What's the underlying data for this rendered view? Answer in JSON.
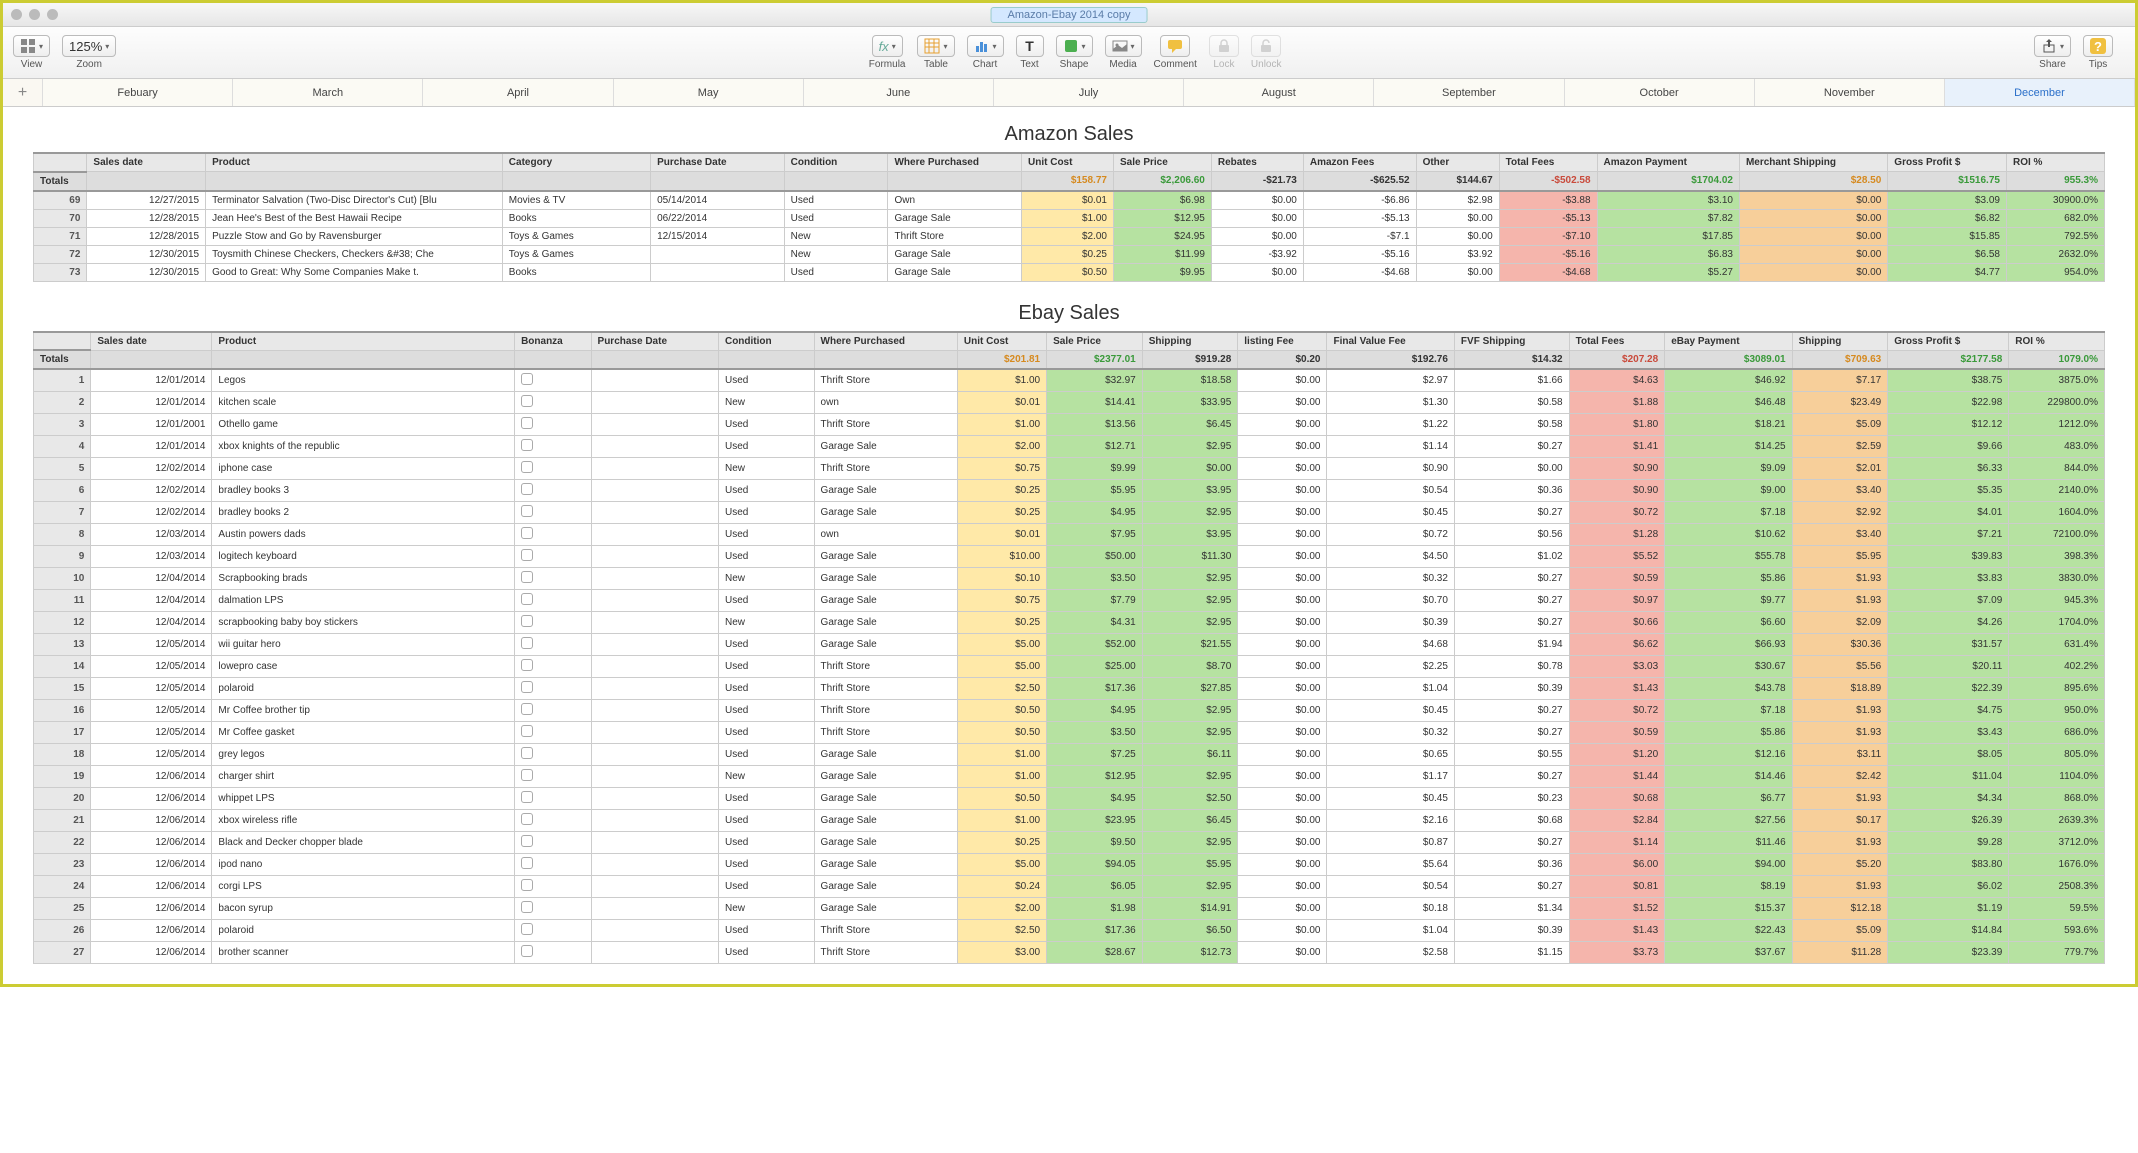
{
  "window": {
    "title": "Amazon-Ebay 2014 copy"
  },
  "toolbar": {
    "view": "View",
    "zoom": "Zoom",
    "zoom_val": "125%",
    "formula": "Formula",
    "table": "Table",
    "chart": "Chart",
    "text": "Text",
    "shape": "Shape",
    "media": "Media",
    "comment": "Comment",
    "lock": "Lock",
    "unlock": "Unlock",
    "share": "Share",
    "tips": "Tips"
  },
  "tabs": [
    "Febuary",
    "March",
    "April",
    "May",
    "June",
    "July",
    "August",
    "September",
    "October",
    "November",
    "December"
  ],
  "active_tab": 10,
  "amazon": {
    "title": "Amazon Sales",
    "headers": [
      "Sales date",
      "Product",
      "Category",
      "Purchase Date",
      "Condition",
      "Where Purchased",
      "Unit Cost",
      "Sale Price",
      "Rebates",
      "Amazon Fees",
      "Other",
      "Total Fees",
      "Amazon Payment",
      "Merchant Shipping",
      "Gross Profit $",
      "ROI %"
    ],
    "totals_label": "Totals",
    "totals": [
      "",
      "",
      "",
      "",
      "",
      "",
      "$158.77",
      "$2,206.60",
      "-$21.73",
      "-$625.52",
      "$144.67",
      "-$502.58",
      "$1704.02",
      "$28.50",
      "$1516.75",
      "955.3%"
    ],
    "rows": [
      {
        "n": "69",
        "d": [
          "12/27/2015",
          "Terminator Salvation (Two-Disc Director's Cut) [Blu",
          "Movies & TV",
          "05/14/2014",
          "Used",
          "Own",
          "$0.01",
          "$6.98",
          "$0.00",
          "-$6.86",
          "$2.98",
          "-$3.88",
          "$3.10",
          "$0.00",
          "$3.09",
          "30900.0%"
        ]
      },
      {
        "n": "70",
        "d": [
          "12/28/2015",
          "Jean Hee's Best of the Best Hawaii Recipe",
          "Books",
          "06/22/2014",
          "Used",
          "Garage Sale",
          "$1.00",
          "$12.95",
          "$0.00",
          "-$5.13",
          "$0.00",
          "-$5.13",
          "$7.82",
          "$0.00",
          "$6.82",
          "682.0%"
        ]
      },
      {
        "n": "71",
        "d": [
          "12/28/2015",
          "Puzzle Stow and Go by Ravensburger",
          "Toys & Games",
          "12/15/2014",
          "New",
          "Thrift Store",
          "$2.00",
          "$24.95",
          "$0.00",
          "-$7.1",
          "$0.00",
          "-$7.10",
          "$17.85",
          "$0.00",
          "$15.85",
          "792.5%"
        ]
      },
      {
        "n": "72",
        "d": [
          "12/30/2015",
          "Toysmith Chinese Checkers, Checkers &#38; Che",
          "Toys & Games",
          "",
          "New",
          "Garage Sale",
          "$0.25",
          "$11.99",
          "-$3.92",
          "-$5.16",
          "$3.92",
          "-$5.16",
          "$6.83",
          "$0.00",
          "$6.58",
          "2632.0%"
        ]
      },
      {
        "n": "73",
        "d": [
          "12/30/2015",
          "Good to Great: Why Some Companies Make t.",
          "Books",
          "",
          "Used",
          "Garage Sale",
          "$0.50",
          "$9.95",
          "$0.00",
          "-$4.68",
          "$0.00",
          "-$4.68",
          "$5.27",
          "$0.00",
          "$4.77",
          "954.0%"
        ]
      }
    ]
  },
  "ebay": {
    "title": "Ebay Sales",
    "headers": [
      "Sales date",
      "Product",
      "Bonanza",
      "Purchase Date",
      "Condition",
      "Where Purchased",
      "Unit Cost",
      "Sale Price",
      "Shipping",
      "listing Fee",
      "Final Value Fee",
      "FVF Shipping",
      "Total Fees",
      "eBay Payment",
      "Shipping",
      "Gross Profit $",
      "ROI %"
    ],
    "totals_label": "Totals",
    "totals": [
      "",
      "",
      "",
      "",
      "",
      "",
      "$201.81",
      "$2377.01",
      "$919.28",
      "$0.20",
      "$192.76",
      "$14.32",
      "$207.28",
      "$3089.01",
      "$709.63",
      "$2177.58",
      "1079.0%"
    ],
    "rows": [
      {
        "n": "1",
        "d": [
          "12/01/2014",
          "Legos",
          "",
          "",
          "Used",
          "Thrift Store",
          "$1.00",
          "$32.97",
          "$18.58",
          "$0.00",
          "$2.97",
          "$1.66",
          "$4.63",
          "$46.92",
          "$7.17",
          "$38.75",
          "3875.0%"
        ]
      },
      {
        "n": "2",
        "d": [
          "12/01/2014",
          "kitchen scale",
          "",
          "",
          "New",
          "own",
          "$0.01",
          "$14.41",
          "$33.95",
          "$0.00",
          "$1.30",
          "$0.58",
          "$1.88",
          "$46.48",
          "$23.49",
          "$22.98",
          "229800.0%"
        ]
      },
      {
        "n": "3",
        "d": [
          "12/01/2001",
          "Othello game",
          "",
          "",
          "Used",
          "Thrift Store",
          "$1.00",
          "$13.56",
          "$6.45",
          "$0.00",
          "$1.22",
          "$0.58",
          "$1.80",
          "$18.21",
          "$5.09",
          "$12.12",
          "1212.0%"
        ]
      },
      {
        "n": "4",
        "d": [
          "12/01/2014",
          "xbox knights of the republic",
          "",
          "",
          "Used",
          "Garage Sale",
          "$2.00",
          "$12.71",
          "$2.95",
          "$0.00",
          "$1.14",
          "$0.27",
          "$1.41",
          "$14.25",
          "$2.59",
          "$9.66",
          "483.0%"
        ]
      },
      {
        "n": "5",
        "d": [
          "12/02/2014",
          "iphone case",
          "",
          "",
          "New",
          "Thrift Store",
          "$0.75",
          "$9.99",
          "$0.00",
          "$0.00",
          "$0.90",
          "$0.00",
          "$0.90",
          "$9.09",
          "$2.01",
          "$6.33",
          "844.0%"
        ]
      },
      {
        "n": "6",
        "d": [
          "12/02/2014",
          "bradley books 3",
          "",
          "",
          "Used",
          "Garage Sale",
          "$0.25",
          "$5.95",
          "$3.95",
          "$0.00",
          "$0.54",
          "$0.36",
          "$0.90",
          "$9.00",
          "$3.40",
          "$5.35",
          "2140.0%"
        ]
      },
      {
        "n": "7",
        "d": [
          "12/02/2014",
          "bradley books 2",
          "",
          "",
          "Used",
          "Garage Sale",
          "$0.25",
          "$4.95",
          "$2.95",
          "$0.00",
          "$0.45",
          "$0.27",
          "$0.72",
          "$7.18",
          "$2.92",
          "$4.01",
          "1604.0%"
        ]
      },
      {
        "n": "8",
        "d": [
          "12/03/2014",
          "Austin powers dads",
          "",
          "",
          "Used",
          "own",
          "$0.01",
          "$7.95",
          "$3.95",
          "$0.00",
          "$0.72",
          "$0.56",
          "$1.28",
          "$10.62",
          "$3.40",
          "$7.21",
          "72100.0%"
        ]
      },
      {
        "n": "9",
        "d": [
          "12/03/2014",
          "logitech keyboard",
          "",
          "",
          "Used",
          "Garage Sale",
          "$10.00",
          "$50.00",
          "$11.30",
          "$0.00",
          "$4.50",
          "$1.02",
          "$5.52",
          "$55.78",
          "$5.95",
          "$39.83",
          "398.3%"
        ]
      },
      {
        "n": "10",
        "d": [
          "12/04/2014",
          "Scrapbooking brads",
          "",
          "",
          "New",
          "Garage Sale",
          "$0.10",
          "$3.50",
          "$2.95",
          "$0.00",
          "$0.32",
          "$0.27",
          "$0.59",
          "$5.86",
          "$1.93",
          "$3.83",
          "3830.0%"
        ]
      },
      {
        "n": "11",
        "d": [
          "12/04/2014",
          "dalmation LPS",
          "",
          "",
          "Used",
          "Garage Sale",
          "$0.75",
          "$7.79",
          "$2.95",
          "$0.00",
          "$0.70",
          "$0.27",
          "$0.97",
          "$9.77",
          "$1.93",
          "$7.09",
          "945.3%"
        ]
      },
      {
        "n": "12",
        "d": [
          "12/04/2014",
          "scrapbooking baby boy stickers",
          "",
          "",
          "New",
          "Garage Sale",
          "$0.25",
          "$4.31",
          "$2.95",
          "$0.00",
          "$0.39",
          "$0.27",
          "$0.66",
          "$6.60",
          "$2.09",
          "$4.26",
          "1704.0%"
        ]
      },
      {
        "n": "13",
        "d": [
          "12/05/2014",
          "wii guitar hero",
          "",
          "",
          "Used",
          "Garage Sale",
          "$5.00",
          "$52.00",
          "$21.55",
          "$0.00",
          "$4.68",
          "$1.94",
          "$6.62",
          "$66.93",
          "$30.36",
          "$31.57",
          "631.4%"
        ]
      },
      {
        "n": "14",
        "d": [
          "12/05/2014",
          "lowepro case",
          "",
          "",
          "Used",
          "Thrift Store",
          "$5.00",
          "$25.00",
          "$8.70",
          "$0.00",
          "$2.25",
          "$0.78",
          "$3.03",
          "$30.67",
          "$5.56",
          "$20.11",
          "402.2%"
        ]
      },
      {
        "n": "15",
        "d": [
          "12/05/2014",
          "polaroid",
          "",
          "",
          "Used",
          "Thrift Store",
          "$2.50",
          "$17.36",
          "$27.85",
          "$0.00",
          "$1.04",
          "$0.39",
          "$1.43",
          "$43.78",
          "$18.89",
          "$22.39",
          "895.6%"
        ]
      },
      {
        "n": "16",
        "d": [
          "12/05/2014",
          "Mr Coffee brother tip",
          "",
          "",
          "Used",
          "Thrift Store",
          "$0.50",
          "$4.95",
          "$2.95",
          "$0.00",
          "$0.45",
          "$0.27",
          "$0.72",
          "$7.18",
          "$1.93",
          "$4.75",
          "950.0%"
        ]
      },
      {
        "n": "17",
        "d": [
          "12/05/2014",
          "Mr Coffee gasket",
          "",
          "",
          "Used",
          "Thrift Store",
          "$0.50",
          "$3.50",
          "$2.95",
          "$0.00",
          "$0.32",
          "$0.27",
          "$0.59",
          "$5.86",
          "$1.93",
          "$3.43",
          "686.0%"
        ]
      },
      {
        "n": "18",
        "d": [
          "12/05/2014",
          "grey legos",
          "",
          "",
          "Used",
          "Garage Sale",
          "$1.00",
          "$7.25",
          "$6.11",
          "$0.00",
          "$0.65",
          "$0.55",
          "$1.20",
          "$12.16",
          "$3.11",
          "$8.05",
          "805.0%"
        ]
      },
      {
        "n": "19",
        "d": [
          "12/06/2014",
          "charger shirt",
          "",
          "",
          "New",
          "Garage Sale",
          "$1.00",
          "$12.95",
          "$2.95",
          "$0.00",
          "$1.17",
          "$0.27",
          "$1.44",
          "$14.46",
          "$2.42",
          "$11.04",
          "1104.0%"
        ]
      },
      {
        "n": "20",
        "d": [
          "12/06/2014",
          "whippet LPS",
          "",
          "",
          "Used",
          "Garage Sale",
          "$0.50",
          "$4.95",
          "$2.50",
          "$0.00",
          "$0.45",
          "$0.23",
          "$0.68",
          "$6.77",
          "$1.93",
          "$4.34",
          "868.0%"
        ]
      },
      {
        "n": "21",
        "d": [
          "12/06/2014",
          "xbox wireless rifle",
          "",
          "",
          "Used",
          "Garage Sale",
          "$1.00",
          "$23.95",
          "$6.45",
          "$0.00",
          "$2.16",
          "$0.68",
          "$2.84",
          "$27.56",
          "$0.17",
          "$26.39",
          "2639.3%"
        ]
      },
      {
        "n": "22",
        "d": [
          "12/06/2014",
          "Black and Decker chopper blade",
          "",
          "",
          "Used",
          "Garage Sale",
          "$0.25",
          "$9.50",
          "$2.95",
          "$0.00",
          "$0.87",
          "$0.27",
          "$1.14",
          "$11.46",
          "$1.93",
          "$9.28",
          "3712.0%"
        ]
      },
      {
        "n": "23",
        "d": [
          "12/06/2014",
          "ipod nano",
          "",
          "",
          "Used",
          "Garage Sale",
          "$5.00",
          "$94.05",
          "$5.95",
          "$0.00",
          "$5.64",
          "$0.36",
          "$6.00",
          "$94.00",
          "$5.20",
          "$83.80",
          "1676.0%"
        ]
      },
      {
        "n": "24",
        "d": [
          "12/06/2014",
          "corgi LPS",
          "",
          "",
          "Used",
          "Garage Sale",
          "$0.24",
          "$6.05",
          "$2.95",
          "$0.00",
          "$0.54",
          "$0.27",
          "$0.81",
          "$8.19",
          "$1.93",
          "$6.02",
          "2508.3%"
        ]
      },
      {
        "n": "25",
        "d": [
          "12/06/2014",
          "bacon syrup",
          "",
          "",
          "New",
          "Garage Sale",
          "$2.00",
          "$1.98",
          "$14.91",
          "$0.00",
          "$0.18",
          "$1.34",
          "$1.52",
          "$15.37",
          "$12.18",
          "$1.19",
          "59.5%"
        ]
      },
      {
        "n": "26",
        "d": [
          "12/06/2014",
          "polaroid",
          "",
          "",
          "Used",
          "Thrift Store",
          "$2.50",
          "$17.36",
          "$6.50",
          "$0.00",
          "$1.04",
          "$0.39",
          "$1.43",
          "$22.43",
          "$5.09",
          "$14.84",
          "593.6%"
        ]
      },
      {
        "n": "27",
        "d": [
          "12/06/2014",
          "brother scanner",
          "",
          "",
          "Used",
          "Thrift Store",
          "$3.00",
          "$28.67",
          "$12.73",
          "$0.00",
          "$2.58",
          "$1.15",
          "$3.73",
          "$37.67",
          "$11.28",
          "$23.39",
          "779.7%"
        ]
      }
    ]
  }
}
